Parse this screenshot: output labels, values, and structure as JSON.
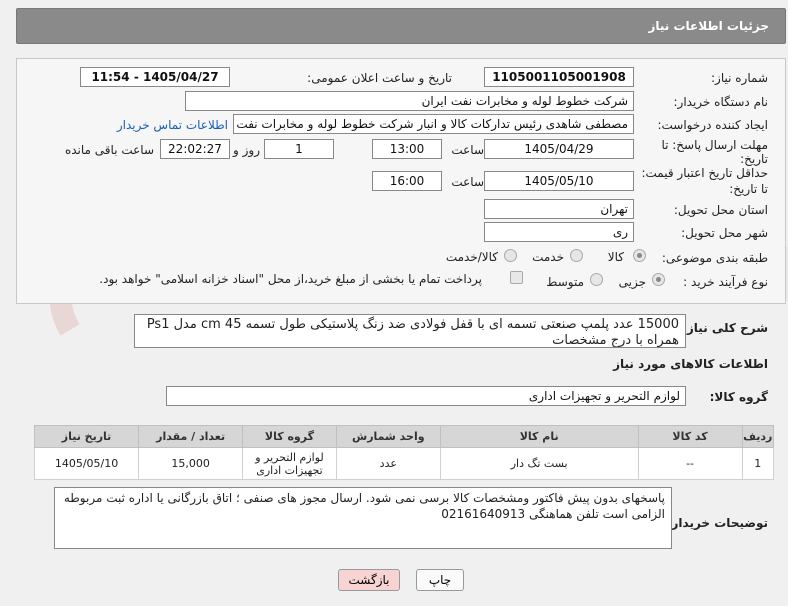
{
  "header": {
    "title": "جزئیات اطلاعات نیاز"
  },
  "fields": {
    "need_number_label": "شماره نیاز:",
    "need_number": "1105001105001908",
    "announce_label": "تاریخ و ساعت اعلان عمومی:",
    "announce_value": "1405/04/27 - 11:54",
    "buyer_label": "نام دستگاه خریدار:",
    "buyer_value": "شرکت خطوط لوله و مخابرات نفت ایران",
    "creator_label": "ایجاد کننده درخواست:",
    "creator_value": "مصطفی  شاهدی رئیس تدارکات کالا و انبار شرکت خطوط لوله و مخابرات نفت ای",
    "contact_link": "اطلاعات تماس خریدار",
    "deadline_label_1": "مهلت ارسال پاسخ: تا",
    "deadline_label_2": "تاریخ:",
    "deadline_date": "1405/04/29",
    "time_label": "ساعت",
    "deadline_time": "13:00",
    "days_value": "1",
    "days_label": "روز و",
    "remaining_time": "22:02:27",
    "remaining_label": "ساعت باقی مانده",
    "price_label_1": "حداقل تاریخ اعتبار قیمت:",
    "price_label_2": "تا تاریخ:",
    "price_date": "1405/05/10",
    "price_time_label": "ساعت",
    "price_time": "16:00",
    "province_label": "استان محل تحویل:",
    "province_value": "تهران",
    "city_label": "شهر محل تحویل:",
    "city_value": "ری",
    "category_label": "طبقه بندی موضوعی:",
    "category_options": [
      "کالا",
      "خدمت",
      "کالا/خدمت"
    ],
    "process_label": "نوع فرآیند خرید :",
    "process_options": [
      "جزیی",
      "متوسط"
    ],
    "payment_text": "پرداخت تمام یا بخشی از مبلغ خرید،از محل \"اسناد خزانه اسلامی\" خواهد بود."
  },
  "description": {
    "label": "شرح کلی نیاز:",
    "text": "15000 عدد پلمپ صنعتی تسمه ای با قفل فولادی ضد زنگ پلاستیکی طول تسمه 45 cm مدل Ps1 همراه با درج مشخصات"
  },
  "goods_info": {
    "title": "اطلاعات کالاهای مورد نیاز"
  },
  "goods_group": {
    "label": "گروه کالا:",
    "value": "لوازم التحریر و تجهیزات اداری"
  },
  "table": {
    "headers": [
      "ردیف",
      "کد کالا",
      "نام کالا",
      "واحد شمارش",
      "گروه کالا",
      "تعداد / مقدار",
      "تاریخ نیاز"
    ],
    "rows": [
      {
        "idx": "1",
        "code": "--",
        "name": "بست تگ دار",
        "unit": "عدد",
        "group": "لوازم التحریر و تجهیزات اداری",
        "qty": "15,000",
        "date": "1405/05/10"
      }
    ]
  },
  "buyer_notes": {
    "label": "توضیحات خریدار:",
    "text": "پاسخهای بدون پیش فاکتور ومشخصات کالا برسی نمی شود. ارسال مجوز های صنفی ؛ اتاق بازرگانی یا اداره ثبت  مربوطه الزامی است تلفن هماهنگی  02161640913"
  },
  "buttons": {
    "print": "چاپ",
    "back": "بازگشت"
  },
  "colors": {
    "header": "#8a8a8a",
    "link": "#1a5fb4",
    "back_button": "#f7d3d3"
  }
}
